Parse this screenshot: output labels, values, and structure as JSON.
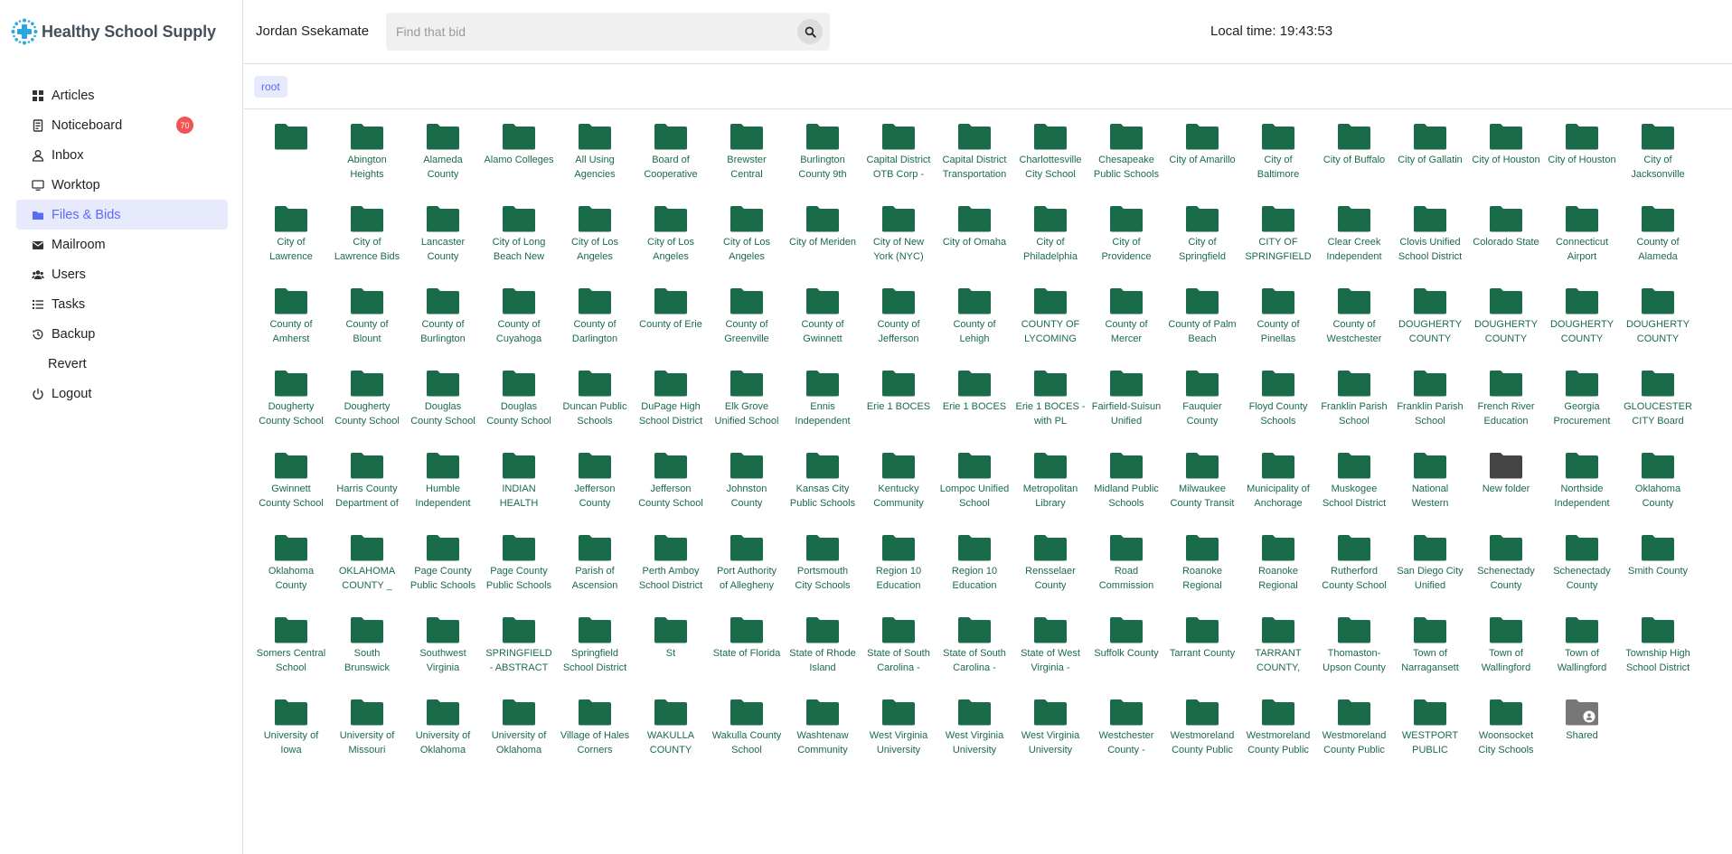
{
  "app": {
    "brand": "Healthy School Supply"
  },
  "sidebar": {
    "items": [
      {
        "label": "Articles",
        "icon": "grid-icon"
      },
      {
        "label": "Noticeboard",
        "icon": "noticeboard-icon",
        "badge": "70"
      },
      {
        "label": "Inbox",
        "icon": "user-icon"
      },
      {
        "label": "Worktop",
        "icon": "monitor-icon"
      },
      {
        "label": "Files & Bids",
        "icon": "folder-icon",
        "active": true
      },
      {
        "label": "Mailroom",
        "icon": "envelope-icon"
      },
      {
        "label": "Users",
        "icon": "users-icon"
      },
      {
        "label": "Tasks",
        "icon": "list-icon"
      },
      {
        "label": "Backup",
        "icon": "history-icon"
      },
      {
        "label": "Revert",
        "icon": "none"
      },
      {
        "label": "Logout",
        "icon": "power-icon"
      }
    ]
  },
  "header": {
    "user": "Jordan Ssekamate",
    "search_placeholder": "Find that bid",
    "search_value": "",
    "localtime": "Local time: 19:43:53"
  },
  "breadcrumb": [
    "root"
  ],
  "colors": {
    "accent": "#5b6cf3",
    "folder": "#1a6b4a",
    "folder_dark": "#444444",
    "shared_folder": "#777777",
    "badge": "#f45353"
  },
  "folders": [
    {
      "label": ""
    },
    {
      "label": "Abington Heights"
    },
    {
      "label": "Alameda County"
    },
    {
      "label": "Alamo Colleges"
    },
    {
      "label": "All Using Agencies"
    },
    {
      "label": "Board of Cooperative"
    },
    {
      "label": "Brewster Central"
    },
    {
      "label": "Burlington County 9th"
    },
    {
      "label": "Capital District OTB Corp -"
    },
    {
      "label": "Capital District Transportation"
    },
    {
      "label": "Charlottesville City School"
    },
    {
      "label": "Chesapeake Public Schools"
    },
    {
      "label": "City of Amarillo"
    },
    {
      "label": "City of Baltimore"
    },
    {
      "label": "City of Buffalo"
    },
    {
      "label": "City of Gallatin"
    },
    {
      "label": "City of Houston"
    },
    {
      "label": "City of Houston"
    },
    {
      "label": "City of Jacksonville"
    },
    {
      "label": "City of Lawrence"
    },
    {
      "label": "City of Lawrence Bids"
    },
    {
      "label": "Lancaster County"
    },
    {
      "label": "City of Long Beach New"
    },
    {
      "label": "City of Los Angeles"
    },
    {
      "label": "City of Los Angeles"
    },
    {
      "label": "City of Los Angeles"
    },
    {
      "label": "City of Meriden"
    },
    {
      "label": "City of New York (NYC)"
    },
    {
      "label": "City of Omaha"
    },
    {
      "label": "City of Philadelphia"
    },
    {
      "label": "City of Providence"
    },
    {
      "label": "City of Springfield"
    },
    {
      "label": "CITY OF SPRINGFIELD"
    },
    {
      "label": "Clear Creek Independent"
    },
    {
      "label": "Clovis Unified School District"
    },
    {
      "label": "Colorado State"
    },
    {
      "label": "Connecticut Airport"
    },
    {
      "label": "County of Alameda"
    },
    {
      "label": "County of Amherst"
    },
    {
      "label": "County of Blount"
    },
    {
      "label": "County of Burlington"
    },
    {
      "label": "County of Cuyahoga"
    },
    {
      "label": "County of Darlington"
    },
    {
      "label": "County of Erie"
    },
    {
      "label": "County of Greenville"
    },
    {
      "label": "County of Gwinnett"
    },
    {
      "label": "County of Jefferson"
    },
    {
      "label": "County of Lehigh"
    },
    {
      "label": "COUNTY OF LYCOMING"
    },
    {
      "label": "County of Mercer"
    },
    {
      "label": "County of Palm Beach"
    },
    {
      "label": "County of Pinellas"
    },
    {
      "label": "County of Westchester"
    },
    {
      "label": "DOUGHERTY COUNTY"
    },
    {
      "label": "DOUGHERTY COUNTY"
    },
    {
      "label": "DOUGHERTY COUNTY"
    },
    {
      "label": "DOUGHERTY COUNTY"
    },
    {
      "label": "Dougherty County School"
    },
    {
      "label": "Dougherty County School"
    },
    {
      "label": "Douglas County School"
    },
    {
      "label": "Douglas County School"
    },
    {
      "label": "Duncan Public Schools"
    },
    {
      "label": "DuPage High School District"
    },
    {
      "label": "Elk Grove Unified School"
    },
    {
      "label": "Ennis Independent"
    },
    {
      "label": "Erie 1 BOCES"
    },
    {
      "label": "Erie 1 BOCES"
    },
    {
      "label": "Erie 1 BOCES - with PL"
    },
    {
      "label": "Fairfield-Suisun Unified"
    },
    {
      "label": "Fauquier County"
    },
    {
      "label": "Floyd County Schools"
    },
    {
      "label": "Franklin Parish School"
    },
    {
      "label": "Franklin Parish School"
    },
    {
      "label": "French River Education"
    },
    {
      "label": "Georgia Procurement"
    },
    {
      "label": "GLOUCESTER CITY Board"
    },
    {
      "label": "Gwinnett County School"
    },
    {
      "label": "Harris County Department of"
    },
    {
      "label": "Humble Independent"
    },
    {
      "label": "INDIAN HEALTH"
    },
    {
      "label": "Jefferson County"
    },
    {
      "label": "Jefferson County School"
    },
    {
      "label": "Johnston County"
    },
    {
      "label": "Kansas City Public Schools"
    },
    {
      "label": "Kentucky Community"
    },
    {
      "label": "Lompoc Unified School"
    },
    {
      "label": "Metropolitan Library"
    },
    {
      "label": "Midland Public Schools"
    },
    {
      "label": "Milwaukee County Transit"
    },
    {
      "label": "Municipality of Anchorage"
    },
    {
      "label": "Muskogee School District"
    },
    {
      "label": "National Western"
    },
    {
      "label": "New folder",
      "variant": "dark"
    },
    {
      "label": "Northside Independent"
    },
    {
      "label": "Oklahoma County"
    },
    {
      "label": "Oklahoma County"
    },
    {
      "label": "OKLAHOMA COUNTY _"
    },
    {
      "label": "Page County Public Schools"
    },
    {
      "label": "Page County Public Schools"
    },
    {
      "label": "Parish of Ascension"
    },
    {
      "label": "Perth Amboy School District"
    },
    {
      "label": "Port Authority of Allegheny"
    },
    {
      "label": "Portsmouth City Schools"
    },
    {
      "label": "Region 10 Education"
    },
    {
      "label": "Region 10 Education"
    },
    {
      "label": "Rensselaer County"
    },
    {
      "label": "Road Commission"
    },
    {
      "label": "Roanoke Regional"
    },
    {
      "label": "Roanoke Regional"
    },
    {
      "label": "Rutherford County School"
    },
    {
      "label": "San Diego City Unified"
    },
    {
      "label": "Schenectady County"
    },
    {
      "label": "Schenectady County"
    },
    {
      "label": "Smith County"
    },
    {
      "label": "Somers Central School"
    },
    {
      "label": "South Brunswick"
    },
    {
      "label": "Southwest Virginia"
    },
    {
      "label": "SPRINGFIELD - ABSTRACT"
    },
    {
      "label": "Springfield School District"
    },
    {
      "label": "St"
    },
    {
      "label": "State of Florida"
    },
    {
      "label": "State of Rhode Island"
    },
    {
      "label": "State of South Carolina -"
    },
    {
      "label": "State of South Carolina -"
    },
    {
      "label": "State of West Virginia -"
    },
    {
      "label": "Suffolk County"
    },
    {
      "label": "Tarrant County"
    },
    {
      "label": "TARRANT COUNTY,"
    },
    {
      "label": "Thomaston-Upson County"
    },
    {
      "label": "Town of Narragansett"
    },
    {
      "label": "Town of Wallingford"
    },
    {
      "label": "Town of Wallingford"
    },
    {
      "label": "Township High School District"
    },
    {
      "label": "University of Iowa"
    },
    {
      "label": "University of Missouri"
    },
    {
      "label": "University of Oklahoma"
    },
    {
      "label": "University of Oklahoma"
    },
    {
      "label": "Village of Hales Corners"
    },
    {
      "label": "WAKULLA COUNTY"
    },
    {
      "label": "Wakulla County School"
    },
    {
      "label": "Washtenaw Community"
    },
    {
      "label": "West Virginia University"
    },
    {
      "label": "West Virginia University"
    },
    {
      "label": "West Virginia University"
    },
    {
      "label": "Westchester County -"
    },
    {
      "label": "Westmoreland County Public"
    },
    {
      "label": "Westmoreland County Public"
    },
    {
      "label": "Westmoreland County Public"
    },
    {
      "label": "WESTPORT PUBLIC"
    },
    {
      "label": "Woonsocket City Schools"
    },
    {
      "label": "Shared",
      "variant": "shared"
    }
  ]
}
